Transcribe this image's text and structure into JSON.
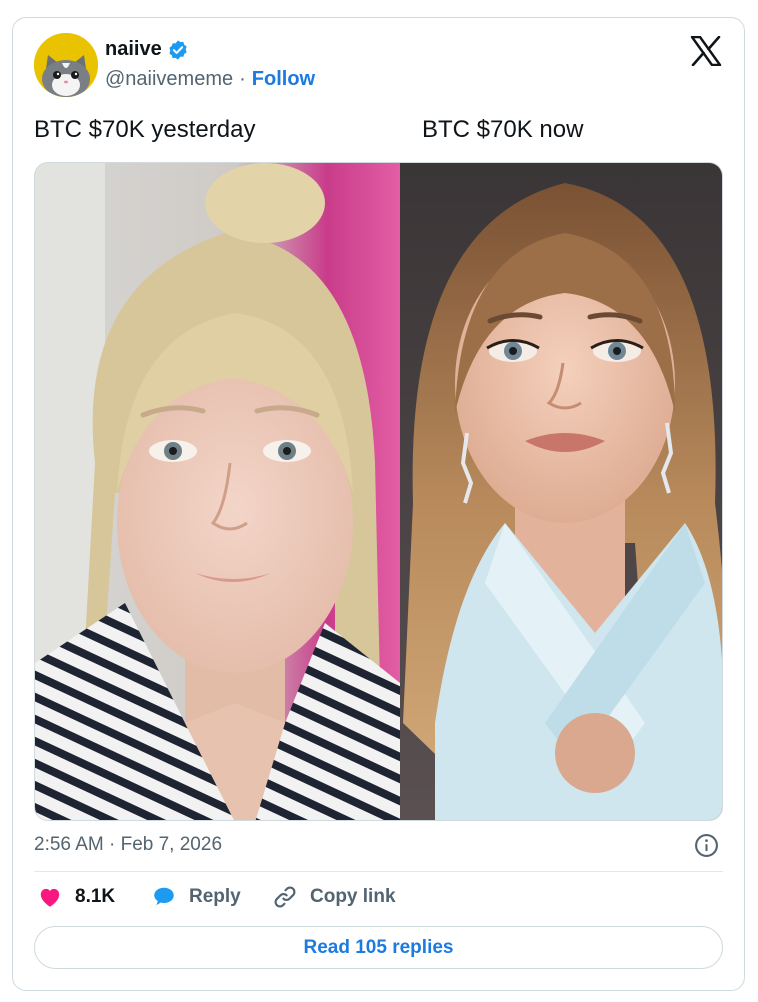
{
  "author": {
    "display_name": "naiive",
    "handle": "@naiivememe",
    "separator": "·",
    "follow_label": "Follow",
    "verified": true,
    "avatar_icon": "cat-avatar-icon",
    "avatar_bg": "#e9c200"
  },
  "tweet": {
    "text_left": "BTC $70K yesterday",
    "text_right": "BTC $70K now"
  },
  "media": {
    "left_icon": "photo-no-makeup-striped-shirt",
    "right_icon": "photo-glam-light-blue-dress"
  },
  "meta": {
    "timestamp": "2:56 AM · Feb 7, 2026"
  },
  "actions": {
    "likes": "8.1K",
    "reply_label": "Reply",
    "copy_label": "Copy link",
    "read_replies_label": "Read 105 replies"
  },
  "colors": {
    "accent": "#1d7ae0",
    "like": "#f91880",
    "reply_icon": "#1d9bf0",
    "muted": "#536471",
    "border": "#cfd9de"
  }
}
